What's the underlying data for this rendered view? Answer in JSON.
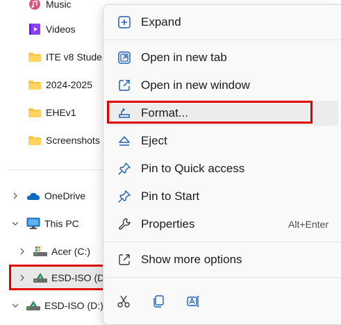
{
  "nav": {
    "items": [
      {
        "label": "Music"
      },
      {
        "label": "Videos"
      },
      {
        "label": "ITE v8 Stude"
      },
      {
        "label": "2024-2025"
      },
      {
        "label": "EHEv1"
      },
      {
        "label": "Screenshots"
      },
      {
        "label": "OneDrive"
      },
      {
        "label": "This PC"
      },
      {
        "label": "Acer (C:)"
      },
      {
        "label": "ESD-ISO (D"
      },
      {
        "label": "ESD-ISO (D:)"
      }
    ]
  },
  "menu": {
    "expand": "Expand",
    "open_new_tab": "Open in new tab",
    "open_new_window": "Open in new window",
    "format": "Format...",
    "eject": "Eject",
    "pin_quick_access": "Pin to Quick access",
    "pin_start": "Pin to Start",
    "properties": "Properties",
    "properties_shortcut": "Alt+Enter",
    "show_more": "Show more options"
  },
  "colors": {
    "highlight_border": "#e00000",
    "icon_blue": "#1a5fb4",
    "folder_yellow": "#f5c542"
  }
}
